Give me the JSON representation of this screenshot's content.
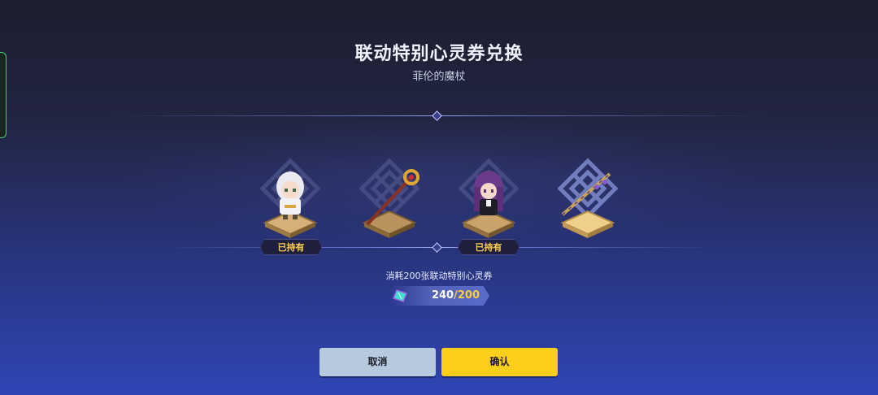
{
  "title": "联动特别心灵券兑换",
  "subtitle": "菲伦的魔杖",
  "items": [
    {
      "name": "character-1",
      "owned_label": "已持有"
    },
    {
      "name": "staff-1",
      "owned_label": ""
    },
    {
      "name": "character-2",
      "owned_label": "已持有"
    },
    {
      "name": "staff-2",
      "owned_label": ""
    }
  ],
  "cost_text": "消耗200张联动特别心灵券",
  "ticket": {
    "have": "240",
    "sep": "/",
    "need": "200"
  },
  "buttons": {
    "cancel": "取消",
    "confirm": "确认"
  },
  "colors": {
    "accent_yellow": "#ffce1a",
    "cancel_blue": "#b7c9dd",
    "owned_text": "#ffcd4a"
  }
}
